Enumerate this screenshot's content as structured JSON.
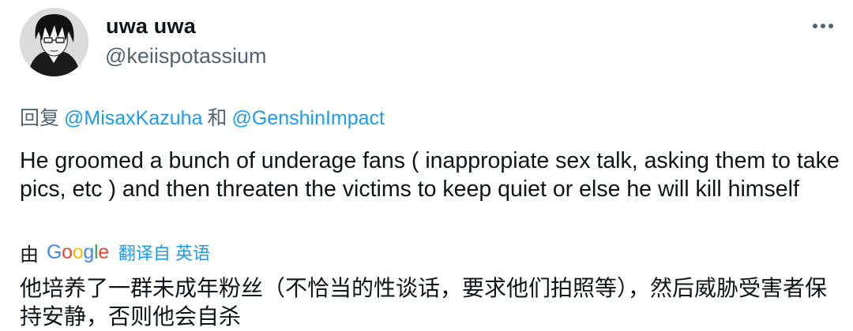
{
  "tweet": {
    "display_name": "uwa uwa",
    "handle": "@keiispotassium",
    "more_icon": "more-horizontal-icon",
    "reply_prefix": "回复",
    "reply_mention_1": "@MisaxKazuha",
    "reply_conjunction": "和",
    "reply_mention_2": "@GenshinImpact",
    "text": "He groomed a bunch of underage fans ( inappropiate sex talk, asking them to take pics, etc ) and then threaten the victims to keep quiet or else he will kill himself",
    "translation": {
      "by_label": "由",
      "provider": "Google",
      "link_text": "翻译自 英语",
      "text": "他培养了一群未成年粉丝（不恰当的性谈话，要求他们拍照等），然后威胁受害者保持安静，否则他会自杀"
    }
  },
  "colors": {
    "text": "#0f1419",
    "secondary": "#536471",
    "link": "#1d9bf0"
  }
}
